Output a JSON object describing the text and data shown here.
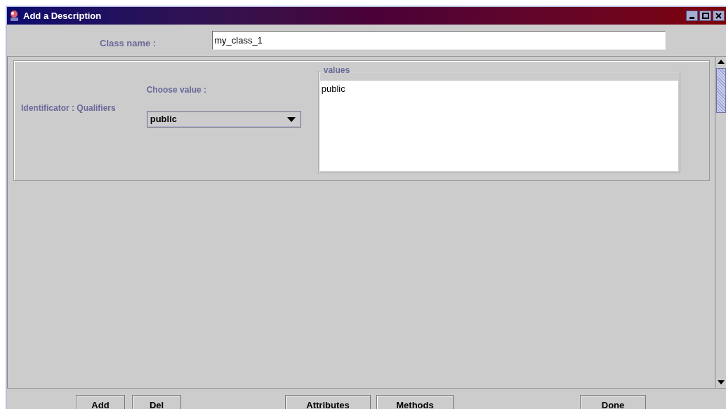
{
  "window": {
    "title": "Add a Description"
  },
  "class_name": {
    "label": "Class name :",
    "value": "my_class_1"
  },
  "qualifier": {
    "label": "Identificator : Qualifiers",
    "choose_label": "Choose value :",
    "selected_value": "public",
    "values_title": "values",
    "values": [
      "public"
    ]
  },
  "buttons": [
    {
      "label": "Add"
    },
    {
      "label": "Del"
    },
    {
      "label": "Attributes"
    },
    {
      "label": "Methods"
    },
    {
      "label": "Done"
    }
  ]
}
